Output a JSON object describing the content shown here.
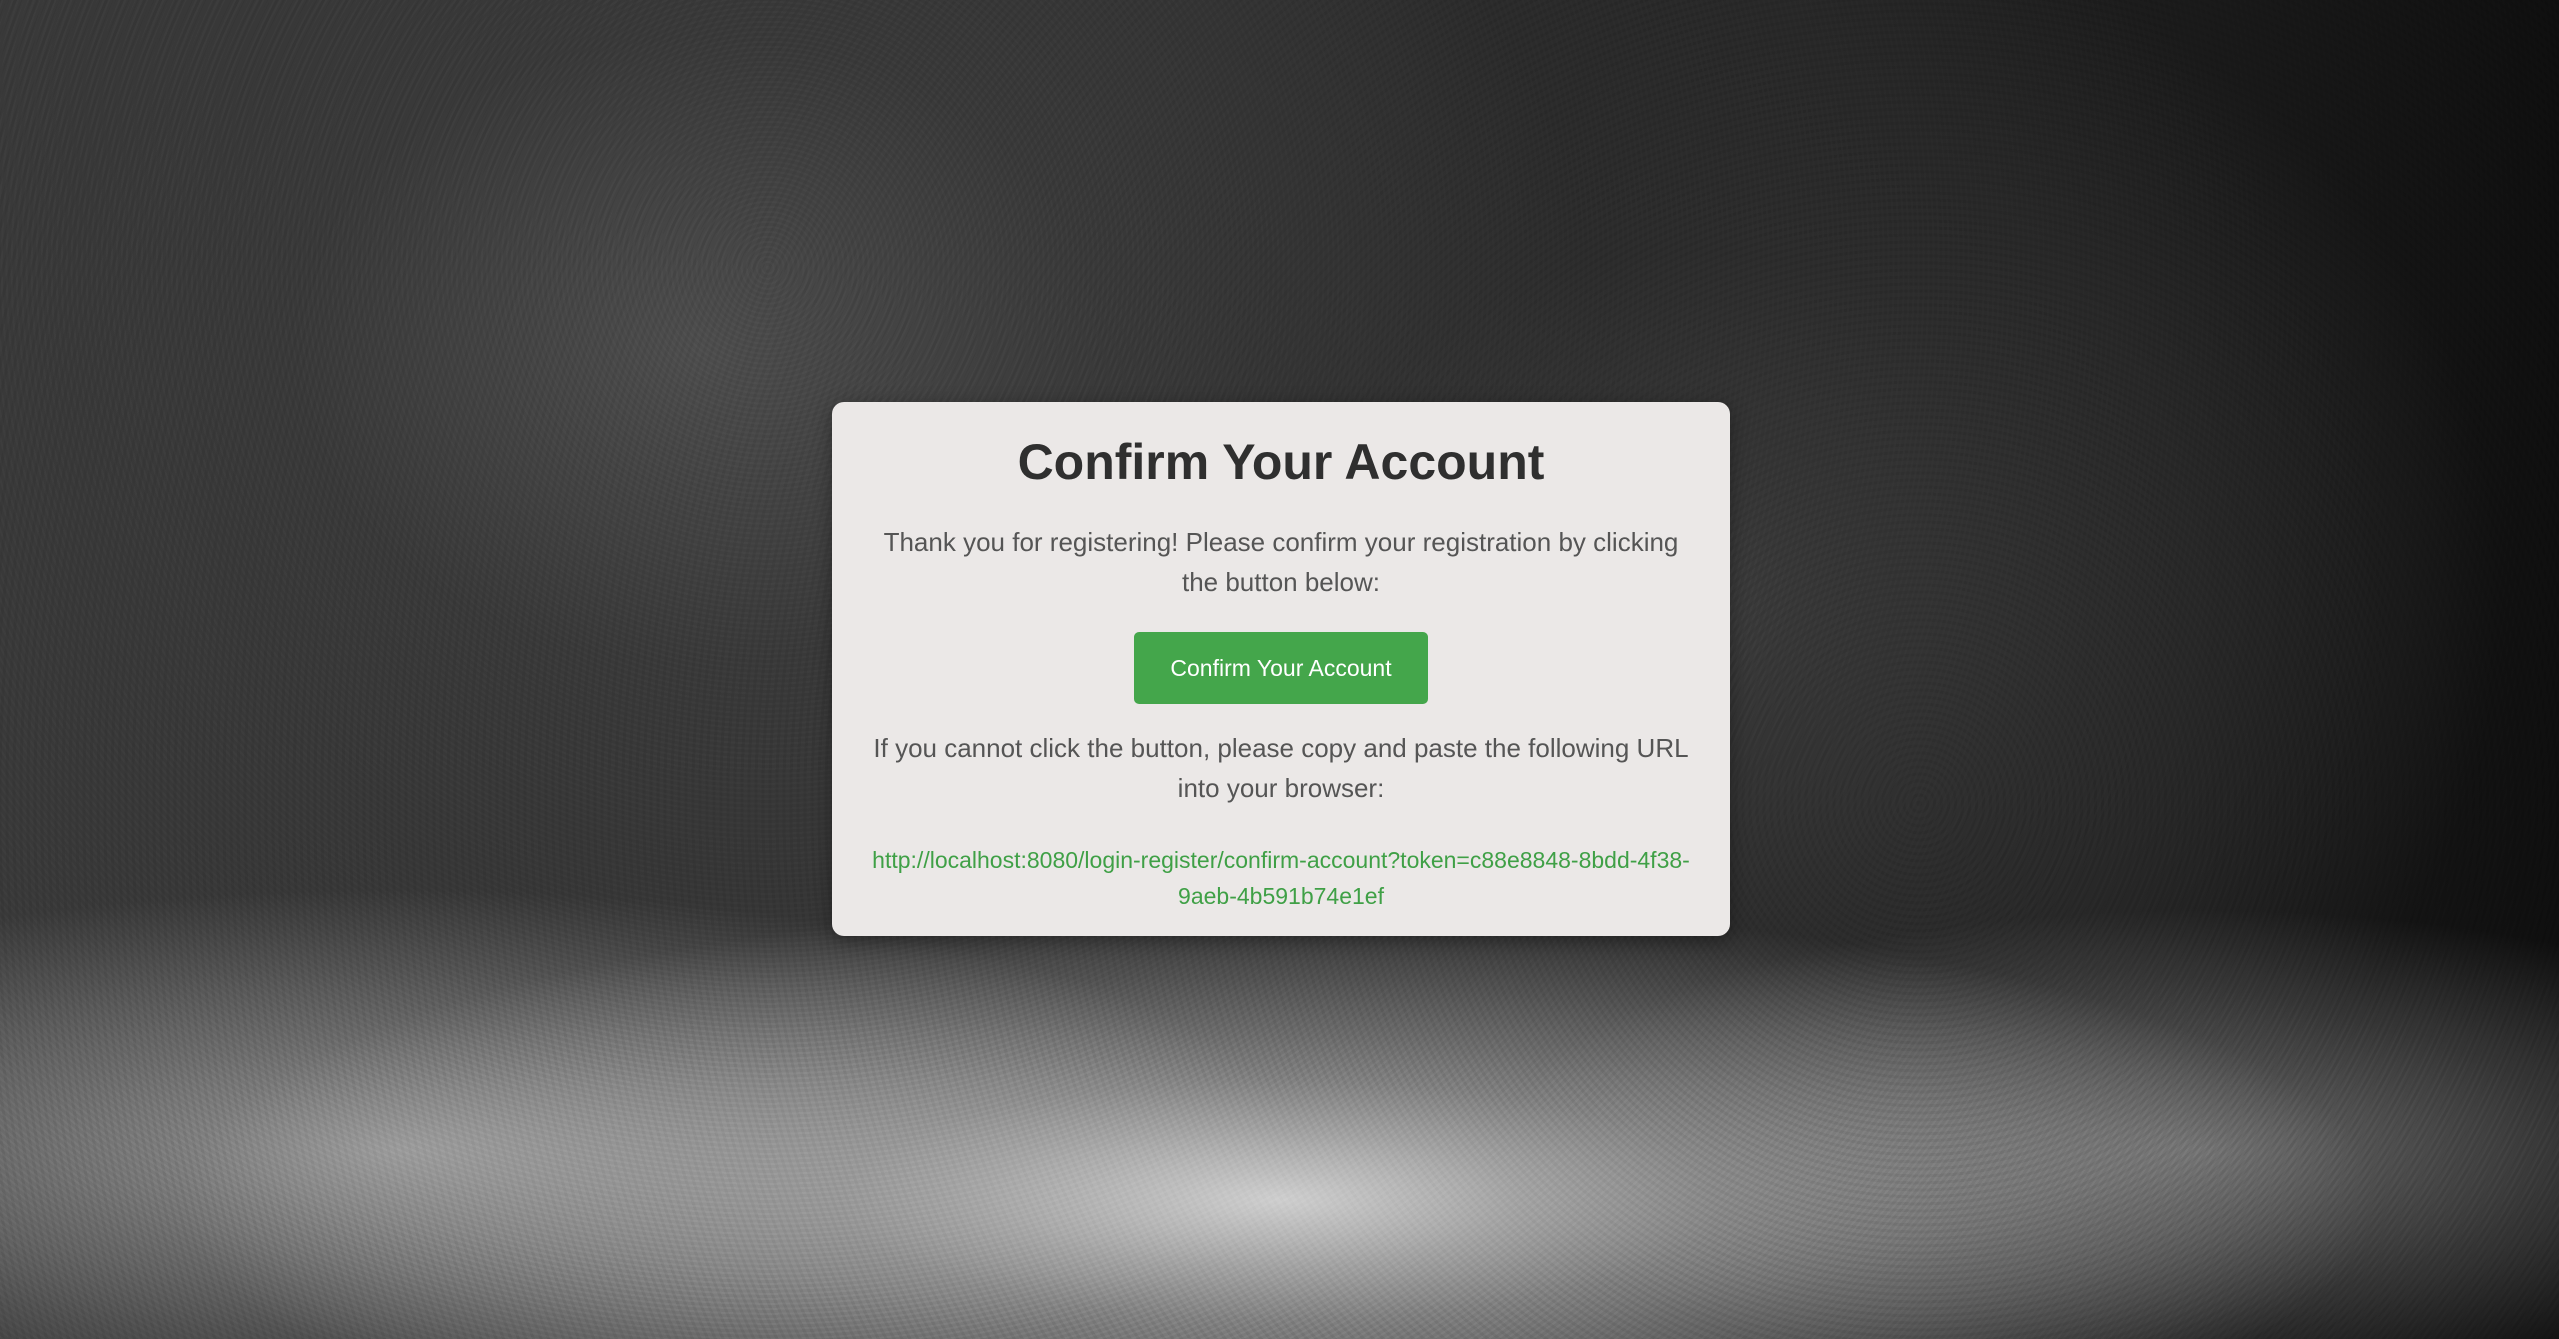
{
  "card": {
    "title": "Confirm Your Account",
    "message": "Thank you for registering! Please confirm your registration by clicking the button below:",
    "button_label": "Confirm Your Account",
    "fallback_message": "If you cannot click the button, please copy and paste the following URL into your browser:",
    "url": "http://localhost:8080/login-register/confirm-account?token=c88e8848-8bdd-4f38-9aeb-4b591b74e1ef"
  },
  "colors": {
    "button": "#44a64b",
    "link": "#3fa046",
    "card_background": "#ebe8e7",
    "title": "#2f2f2f"
  }
}
